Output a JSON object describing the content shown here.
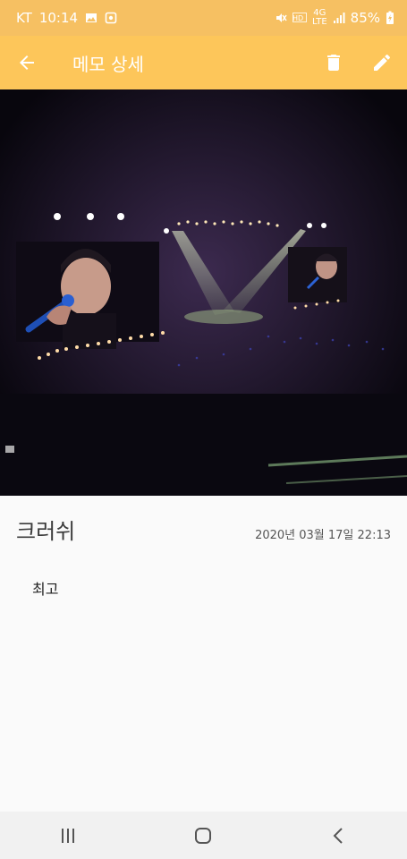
{
  "status_bar": {
    "carrier": "KT",
    "time": "10:14",
    "network_label": "4G",
    "lte_label": "LTE",
    "battery": "85%",
    "icons": [
      "gallery-icon",
      "app-notification-icon",
      "mute-icon",
      "hd-voice-icon",
      "lte-icon",
      "signal-icon",
      "battery-charging-icon"
    ]
  },
  "app_bar": {
    "title": "메모 상세",
    "back_icon": "arrow-left-icon",
    "delete_icon": "trash-icon",
    "edit_icon": "pencil-icon",
    "background": "#fdc65a"
  },
  "memo": {
    "photo_desc": "concert-photo",
    "title": "크러쉬",
    "date": "2020년 03월 17일 22:13",
    "content": "최고"
  },
  "nav_bar": {
    "icons": [
      "recent-apps-icon",
      "home-icon",
      "back-icon"
    ]
  }
}
